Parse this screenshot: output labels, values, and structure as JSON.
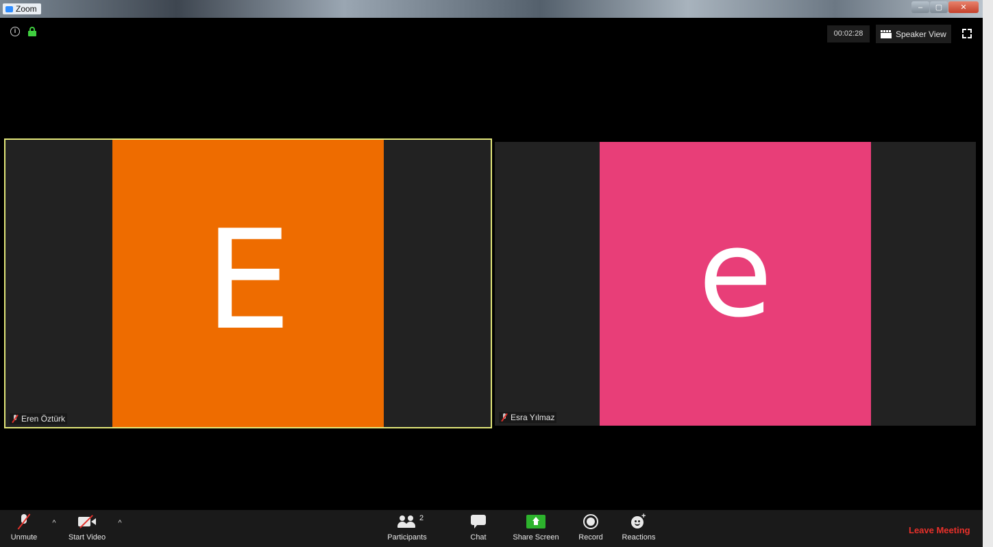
{
  "window": {
    "app_title": "Zoom"
  },
  "header": {
    "timer": "00:02:28",
    "view_label": "Speaker View"
  },
  "participants": [
    {
      "initial": "E",
      "name": "Eren Öztürk",
      "avatar_color": "#ee6c00",
      "active_speaker": true,
      "muted": true
    },
    {
      "initial": "e",
      "name": "Esra Yılmaz",
      "avatar_color": "#e83e78",
      "active_speaker": false,
      "muted": true
    }
  ],
  "toolbar": {
    "unmute_label": "Unmute",
    "start_video_label": "Start Video",
    "participants_label": "Participants",
    "participants_count": "2",
    "chat_label": "Chat",
    "share_screen_label": "Share Screen",
    "record_label": "Record",
    "reactions_label": "Reactions",
    "leave_label": "Leave Meeting"
  },
  "colors": {
    "active_border": "#e3e77a",
    "leave": "#e8302a",
    "share": "#2db32d",
    "lock": "#3fcf3f"
  }
}
